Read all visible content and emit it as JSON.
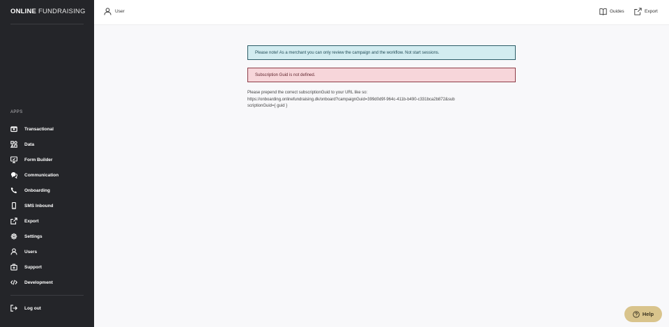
{
  "brand": {
    "bold": "ONLINE",
    "light": "FUNDRAISING"
  },
  "sidebar": {
    "section_label": "APPS",
    "items": [
      {
        "label": "Transactional",
        "icon": "wallet-icon"
      },
      {
        "label": "Data",
        "icon": "data-icon"
      },
      {
        "label": "Form Builder",
        "icon": "monitor-icon"
      },
      {
        "label": "Communication",
        "icon": "chat-icon"
      },
      {
        "label": "Onboarding",
        "icon": "phone-icon"
      },
      {
        "label": "SMS Inbound",
        "icon": "mobile-icon"
      },
      {
        "label": "Export",
        "icon": "export-icon"
      },
      {
        "label": "Settings",
        "icon": "gear-icon"
      },
      {
        "label": "Users",
        "icon": "user-icon"
      },
      {
        "label": "Support",
        "icon": "support-icon"
      },
      {
        "label": "Development",
        "icon": "code-icon"
      }
    ],
    "logout": "Log out"
  },
  "header": {
    "user_label": "User",
    "guides_label": "Guides",
    "export_label": "Export"
  },
  "alerts": {
    "info": "Please note! As a merchant you can only review the campaign and the workflow. Not start sessions.",
    "error": "Subscription Guid is not defined."
  },
  "message": {
    "line1": "Please prepend the correct subscriptionGuid to your URL like so:",
    "url": "https://onboarding.onlinefundraising.dk/onboard?campaignGuid=399d0d9f-964c-411b-b490-c331bca2b872&subscriptionGuid={ guid }"
  },
  "help": {
    "label": "Help"
  },
  "colors": {
    "sidebar_bg": "#242529",
    "info_bg": "#d2ecf0",
    "error_bg": "#f7d6da",
    "help_bg": "#d9c48c"
  }
}
